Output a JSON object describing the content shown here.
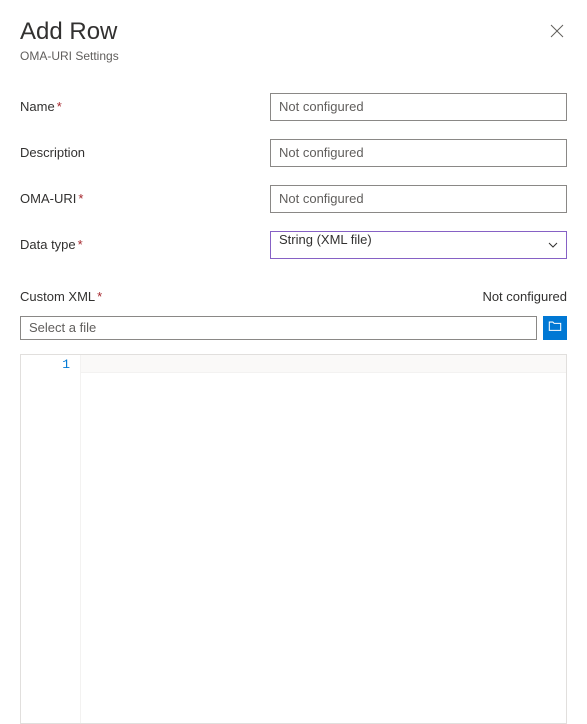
{
  "header": {
    "title": "Add Row",
    "subtitle": "OMA-URI Settings"
  },
  "fields": {
    "name": {
      "label": "Name",
      "placeholder": "Not configured",
      "value": ""
    },
    "description": {
      "label": "Description",
      "placeholder": "Not configured",
      "value": ""
    },
    "omaUri": {
      "label": "OMA-URI",
      "placeholder": "Not configured",
      "value": ""
    },
    "dataType": {
      "label": "Data type",
      "value": "String (XML file)"
    }
  },
  "customXml": {
    "label": "Custom XML",
    "status": "Not configured",
    "filePlaceholder": "Select a file",
    "fileValue": "",
    "lineNumber": "1"
  },
  "required": "*"
}
